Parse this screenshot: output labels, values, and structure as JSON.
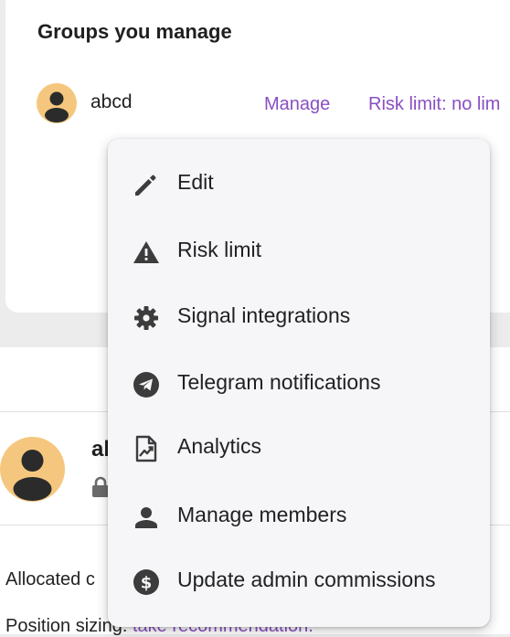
{
  "groups_card": {
    "title": "Groups you manage",
    "group": {
      "name": "abcd",
      "manage_link": "Manage",
      "risk_link": "Risk limit: no lim"
    }
  },
  "profile": {
    "name_partial": "al",
    "allocated_partial": "Allocated c",
    "position_label": "Position sizing:",
    "position_value": "take recommendation."
  },
  "menu": {
    "items": [
      {
        "label": "Edit",
        "icon": "pencil-icon"
      },
      {
        "label": "Risk limit",
        "icon": "warning-icon"
      },
      {
        "label": "Signal integrations",
        "icon": "gear-icon"
      },
      {
        "label": "Telegram notifications",
        "icon": "telegram-icon"
      },
      {
        "label": "Analytics",
        "icon": "analytics-icon"
      },
      {
        "label": "Manage members",
        "icon": "person-icon"
      },
      {
        "label": "Update admin commissions",
        "icon": "dollar-icon"
      }
    ]
  },
  "colors": {
    "accent": "#8a4fc2",
    "avatar_bg": "#f5c77e",
    "menu_bg": "#f6f6f8",
    "icon": "#3c3c3c"
  }
}
